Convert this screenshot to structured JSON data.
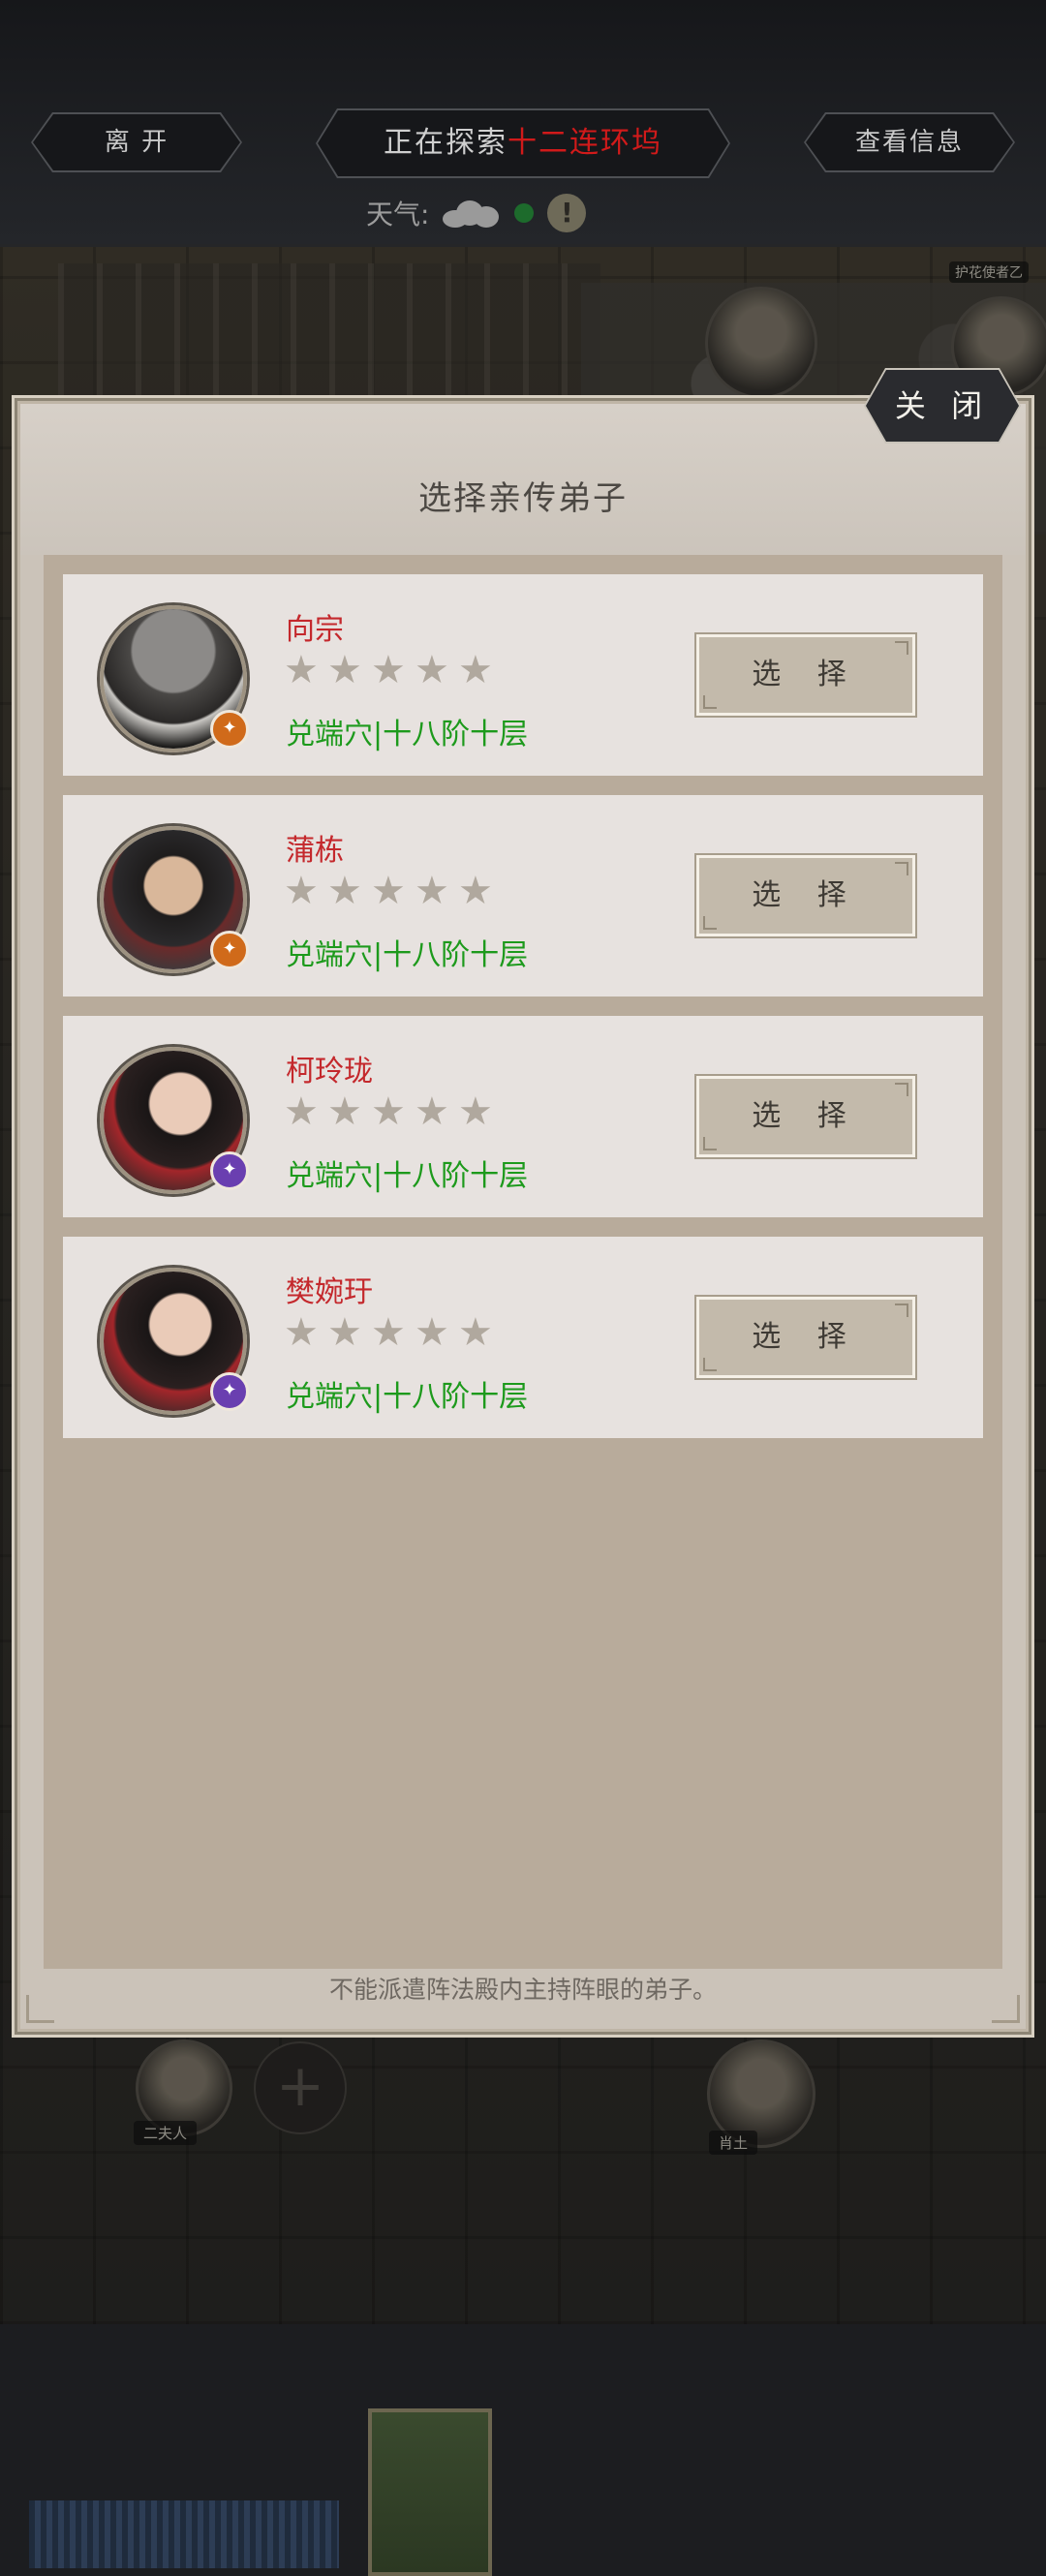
{
  "topbar": {
    "leave_label": "离 开",
    "exploring_prefix": "正在探索",
    "exploring_location": "十二连环坞",
    "info_label": "查看信息",
    "weather_label": "天气:"
  },
  "scene": {
    "char_labels": [
      "护花使者乙",
      "二夫人",
      "肖土"
    ]
  },
  "panel": {
    "close_label": "关 闭",
    "title": "选择亲传弟子",
    "select_label": "选 择",
    "footer_note": "不能派遣阵法殿内主持阵眼的弟子。",
    "disciples": [
      {
        "name": "向宗",
        "stars": 5,
        "realm": "兑端穴|十八阶十层",
        "badge_color": "#d06a1a"
      },
      {
        "name": "蒲栋",
        "stars": 5,
        "realm": "兑端穴|十八阶十层",
        "badge_color": "#d06a1a"
      },
      {
        "name": "柯玲珑",
        "stars": 5,
        "realm": "兑端穴|十八阶十层",
        "badge_color": "#6a3fb0"
      },
      {
        "name": "樊婉玗",
        "stars": 5,
        "realm": "兑端穴|十八阶十层",
        "badge_color": "#6a3fb0"
      }
    ]
  },
  "colors": {
    "name_red": "#c4282c",
    "realm_green": "#1d9a1c",
    "location_red": "#d11a1a"
  }
}
